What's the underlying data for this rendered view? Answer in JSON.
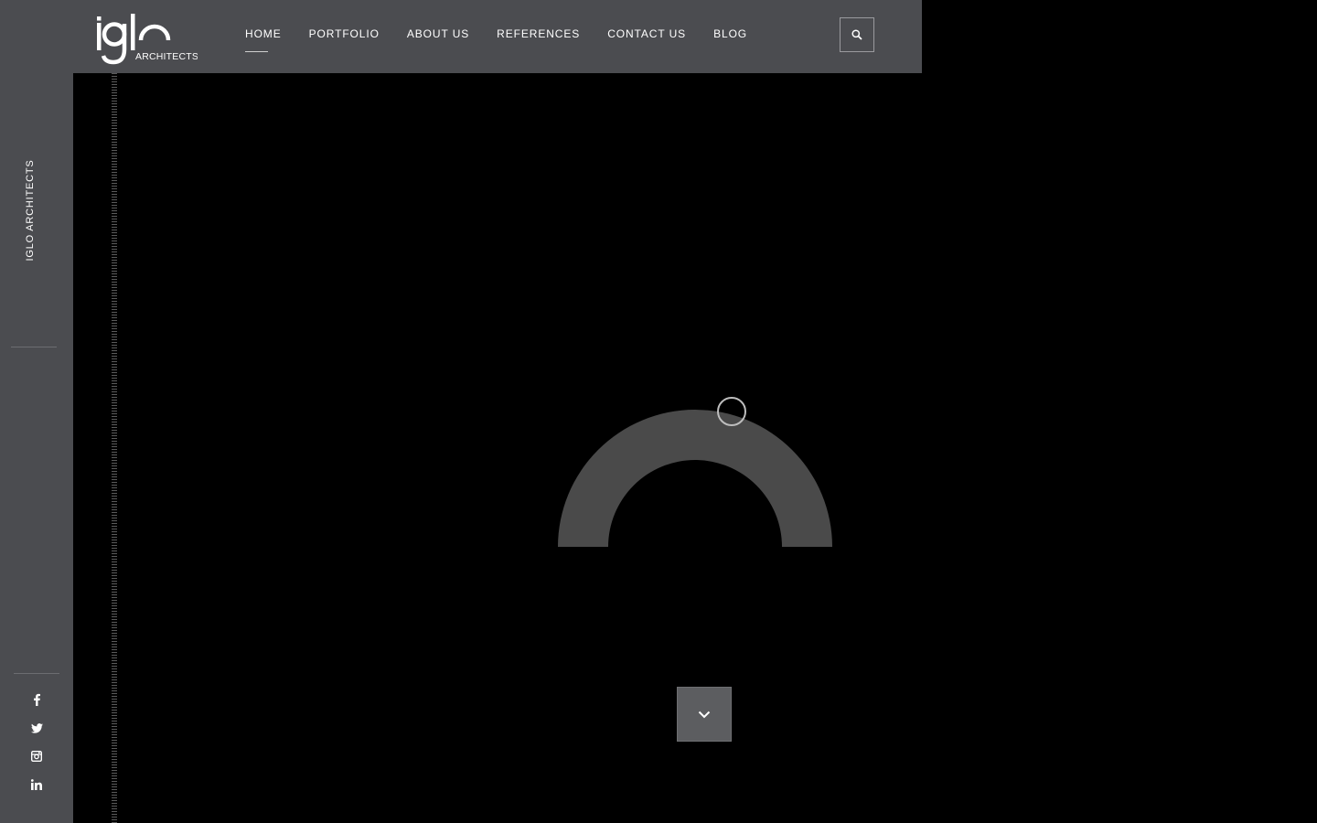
{
  "brand": {
    "logo_word": "iglo",
    "logo_sub": "ARCHITECTS",
    "sidebar_title": "IGLO ARCHITECTS"
  },
  "nav": {
    "items": [
      {
        "label": "HOME",
        "active": true
      },
      {
        "label": "PORTFOLIO"
      },
      {
        "label": "ABOUT US"
      },
      {
        "label": "REFERENCES"
      },
      {
        "label": "CONTACT US"
      },
      {
        "label": "BLOG"
      }
    ]
  },
  "header": {
    "search_icon": "search-icon"
  },
  "social": [
    "facebook-icon",
    "twitter-icon",
    "instagram-icon",
    "linkedin-icon"
  ],
  "hero": {
    "scroll_icon": "chevron-down-icon"
  },
  "colors": {
    "panel": "#4b4c50",
    "background": "#000000",
    "loader_arc": "#4a4a4a",
    "text": "#ffffff"
  }
}
